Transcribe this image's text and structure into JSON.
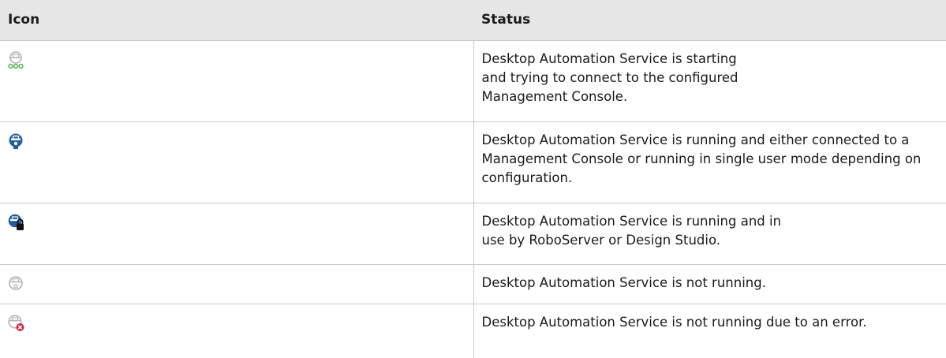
{
  "table": {
    "headers": {
      "icon": "Icon",
      "status": "Status"
    },
    "rows": [
      {
        "icon": "robot-starting-icon",
        "status": "Desktop Automation Service is starting and trying to connect to the configured Management Console."
      },
      {
        "icon": "robot-running-icon",
        "status": "Desktop Automation Service is running and either connected to a Management Console or running in single user mode depending on configuration."
      },
      {
        "icon": "robot-in-use-lock-icon",
        "status": "Desktop Automation Service is running and in use by RoboServer or Design Studio."
      },
      {
        "icon": "robot-not-running-icon",
        "status": "Desktop Automation Service is not running."
      },
      {
        "icon": "robot-error-icon",
        "status": "Desktop Automation Service is not running due to an error."
      }
    ]
  },
  "colors": {
    "header_bg": "#e6e6e6",
    "border": "#c8c8c8",
    "robot_blue": "#1f5f9e",
    "robot_gray": "#b3b3b3",
    "starting_green": "#5cb85c",
    "error_red": "#d9253b"
  }
}
